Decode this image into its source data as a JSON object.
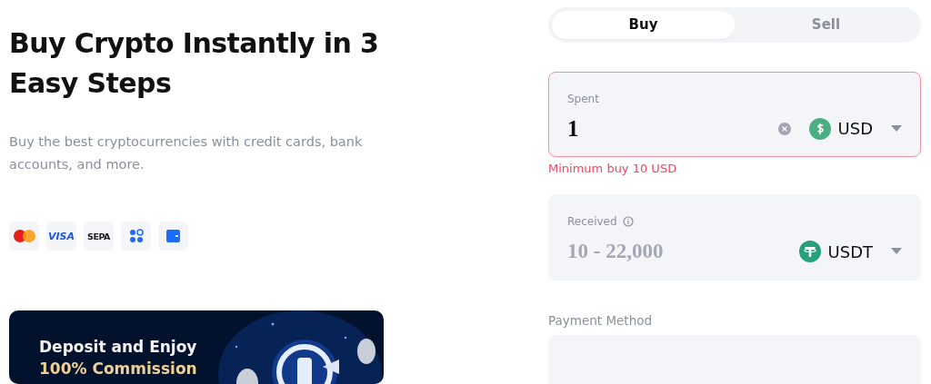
{
  "hero": {
    "title": "Buy Crypto Instantly in 3 Easy Steps",
    "subtitle": "Buy the best cryptocurrencies with credit cards, bank accounts, and more."
  },
  "payment_badges": [
    {
      "kind": "mastercard"
    },
    {
      "kind": "visa",
      "label": "VISA"
    },
    {
      "kind": "sepa",
      "label": "SEPA"
    },
    {
      "kind": "dots"
    },
    {
      "kind": "wallet"
    }
  ],
  "banner": {
    "line_1": "Deposit and Enjoy",
    "line_2": "100% Commission"
  },
  "tabs": [
    {
      "label": "Buy",
      "selected": true
    },
    {
      "label": "Sell",
      "selected": false
    }
  ],
  "spent": {
    "label": "Spent",
    "value": "1",
    "invalid": true,
    "currency": {
      "code": "USD",
      "kind": "dollar"
    },
    "error": "Minimum buy 10 USD"
  },
  "received": {
    "label": "Received",
    "placeholder": "10 - 22,000",
    "currency": {
      "code": "USDT",
      "kind": "tether"
    }
  },
  "payment_method": {
    "label": "Payment Method"
  }
}
